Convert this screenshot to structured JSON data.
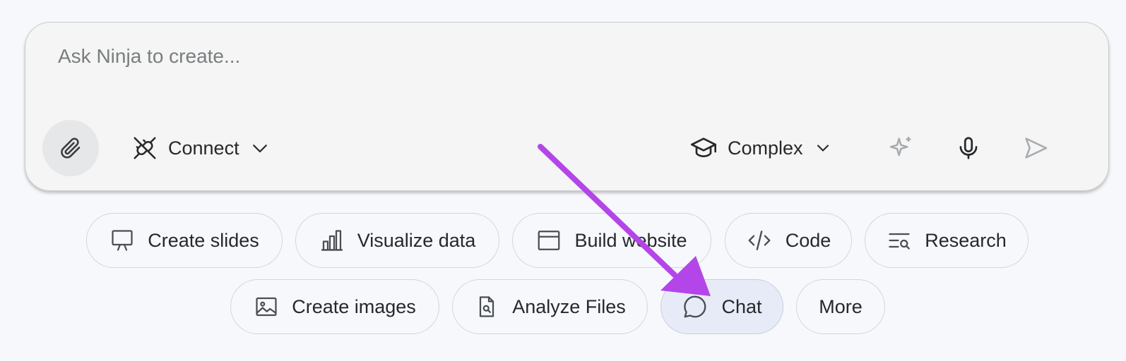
{
  "composer": {
    "placeholder": "Ask Ninja to create...",
    "attach_icon": "paperclip-icon",
    "connect": {
      "label": "Connect",
      "icon": "unplug-icon",
      "caret": "chevron-down-icon"
    },
    "mode": {
      "label": "Complex",
      "icon": "graduation-cap-icon",
      "caret": "chevron-down-icon"
    },
    "actions": [
      {
        "name": "sparkle-icon",
        "role": "enhance prompt"
      },
      {
        "name": "microphone-icon",
        "role": "voice input"
      },
      {
        "name": "send-icon",
        "role": "send"
      }
    ]
  },
  "suggestions": {
    "row1": [
      {
        "label": "Create slides",
        "icon": "presentation-icon"
      },
      {
        "label": "Visualize data",
        "icon": "bar-chart-icon"
      },
      {
        "label": "Build website",
        "icon": "browser-window-icon"
      },
      {
        "label": "Code",
        "icon": "code-icon"
      },
      {
        "label": "Research",
        "icon": "research-icon"
      }
    ],
    "row2": [
      {
        "label": "Create images",
        "icon": "image-icon"
      },
      {
        "label": "Analyze Files",
        "icon": "file-search-icon"
      },
      {
        "label": "Chat",
        "icon": "chat-bubble-icon",
        "selected": true
      },
      {
        "label": "More",
        "icon": ""
      }
    ]
  },
  "colors": {
    "page_bg": "#f7f8fb",
    "composer_bg": "#f4f5f4",
    "chip_selected_bg": "#e6ebf7",
    "annotation_arrow": "#b445e8",
    "text": "#26282b",
    "muted_icon": "#9aa0a6"
  }
}
